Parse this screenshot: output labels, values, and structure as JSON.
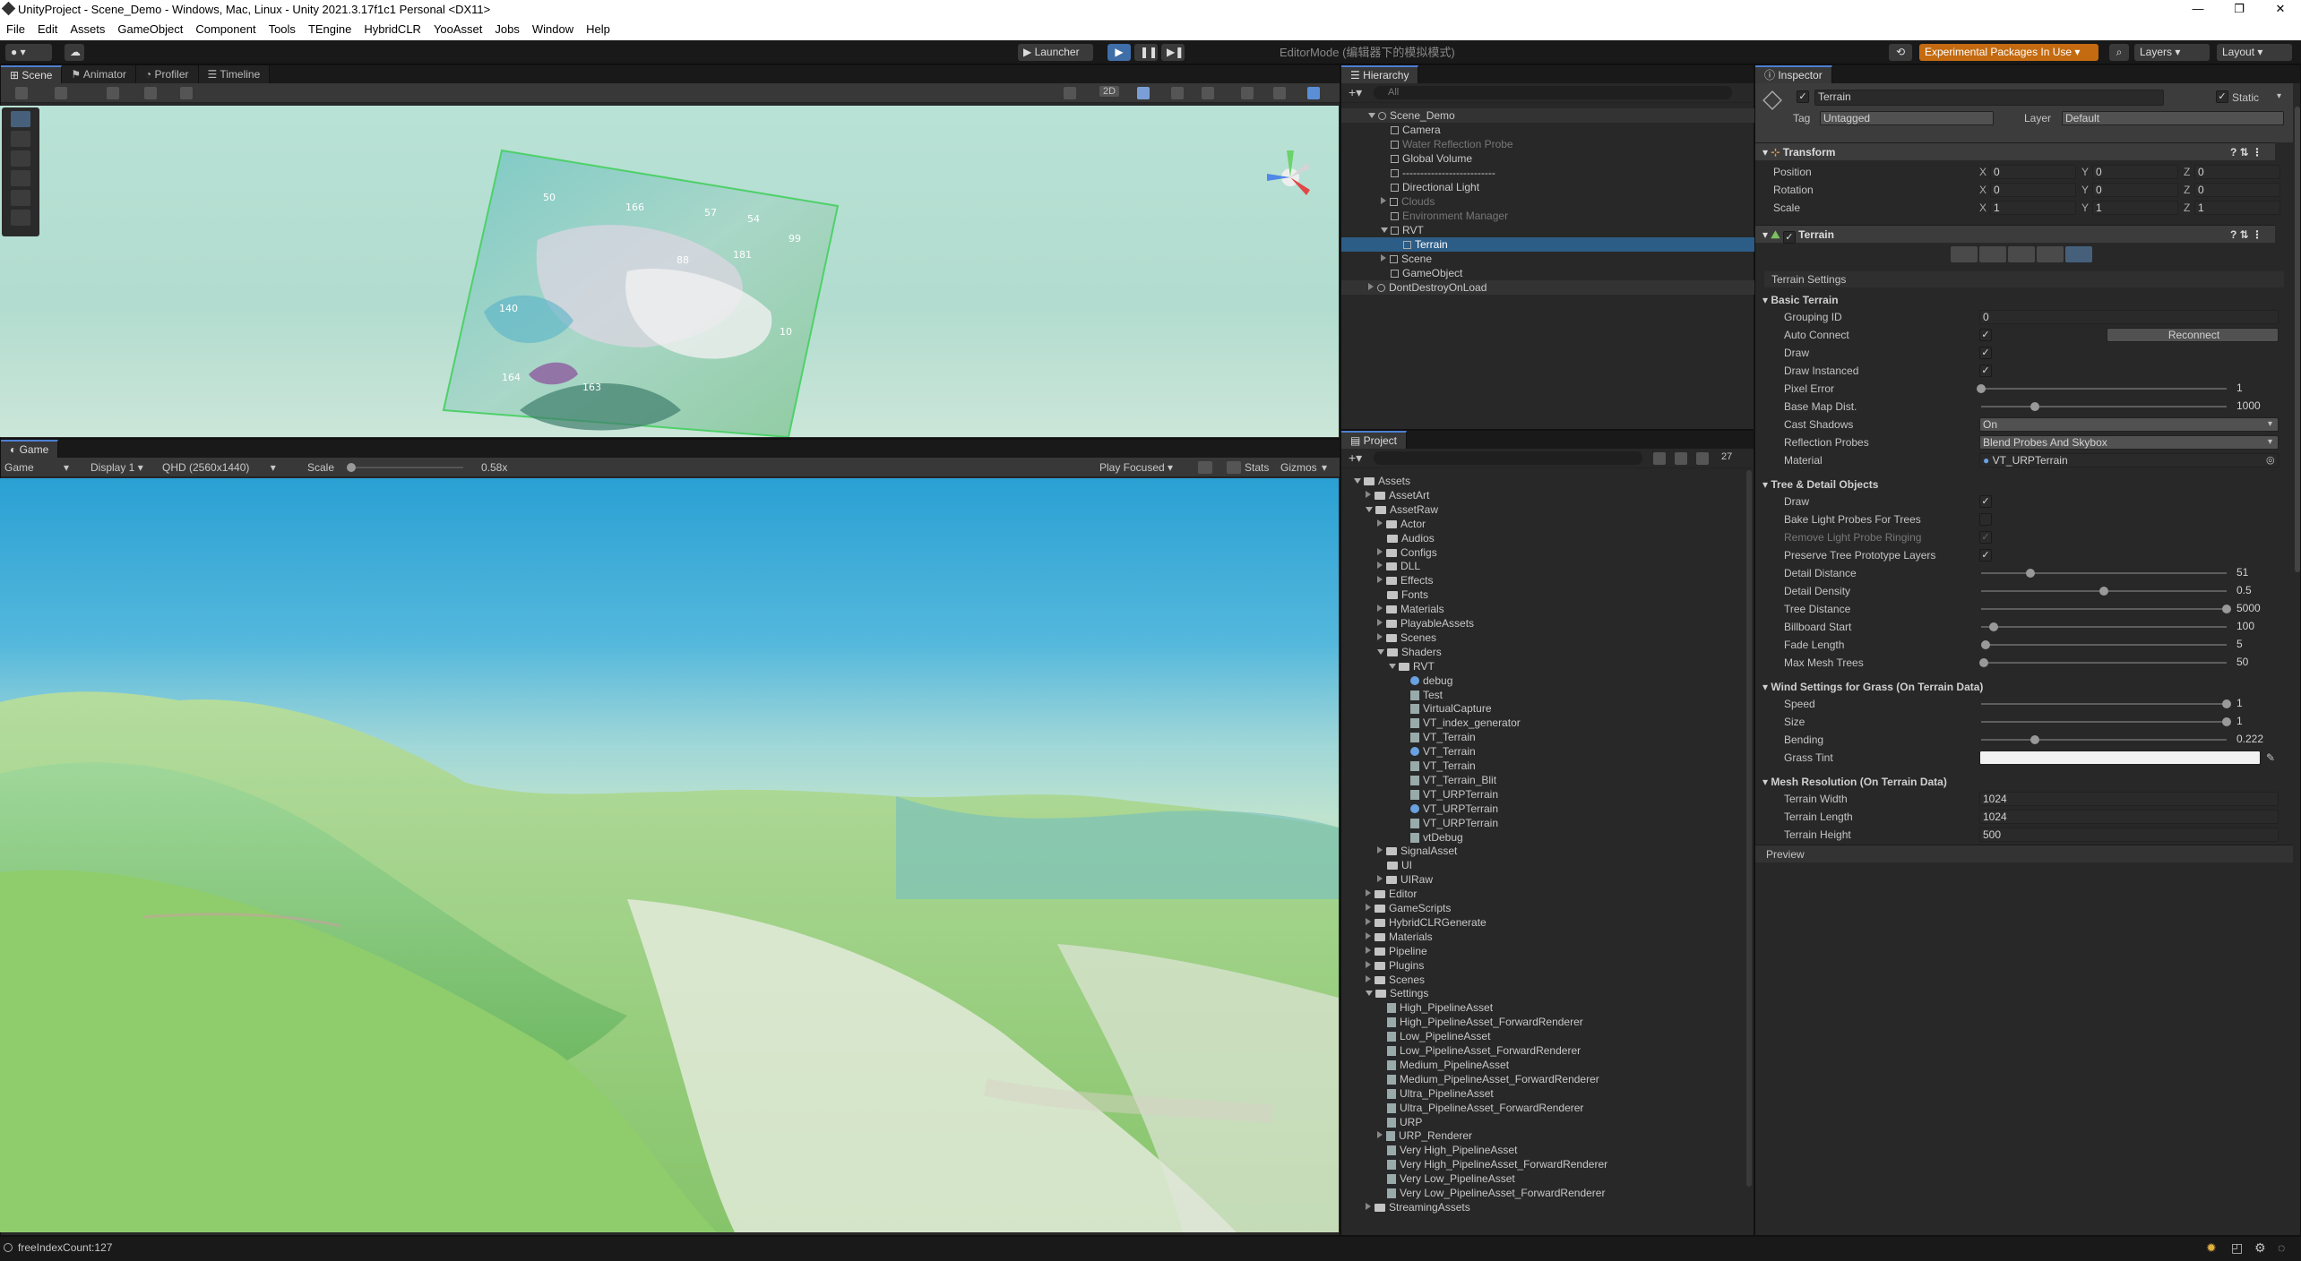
{
  "window": {
    "title": "UnityProject - Scene_Demo - Windows, Mac, Linux - Unity 2021.3.17f1c1 Personal <DX11>",
    "controls": [
      "—",
      "❐",
      "✕"
    ]
  },
  "menu": [
    "File",
    "Edit",
    "Assets",
    "GameObject",
    "Component",
    "Tools",
    "TEngine",
    "HybridCLR",
    "YooAsset",
    "Jobs",
    "Window",
    "Help"
  ],
  "toolbar": {
    "launcher": "Launcher",
    "mode": "EditorMode (编辑器下的模拟模式)",
    "experimental": "Experimental Packages In Use ▾",
    "layers": "Layers",
    "layout": "Layout"
  },
  "scene_tabs": [
    "Scene",
    "Animator",
    "Profiler",
    "Timeline"
  ],
  "scene": {
    "view_2d": "2D",
    "terrain_numbers": [
      "166",
      "57",
      "50",
      "88",
      "140",
      "164",
      "163",
      "181",
      "99",
      "54",
      "10"
    ]
  },
  "game": {
    "tab": "Game",
    "display_mode": "Game",
    "display": "Display 1",
    "resolution": "QHD (2560x1440)",
    "scale_label": "Scale",
    "scale_value": "0.58x",
    "scale_level": 0.04,
    "play_focused": "Play Focused",
    "stats": "Stats",
    "gizmos": "Gizmos"
  },
  "hierarchy": {
    "tab": "Hierarchy",
    "search": "All",
    "items": [
      {
        "label": "Scene_Demo",
        "depth": 0,
        "kind": "scene",
        "expanded": true
      },
      {
        "label": "Camera",
        "depth": 1,
        "kind": "go"
      },
      {
        "label": "Water Reflection Probe",
        "depth": 1,
        "kind": "go",
        "dim": true
      },
      {
        "label": "Global Volume",
        "depth": 1,
        "kind": "go"
      },
      {
        "label": "--------------------------",
        "depth": 1,
        "kind": "go"
      },
      {
        "label": "Directional Light",
        "depth": 1,
        "kind": "go"
      },
      {
        "label": "Clouds",
        "depth": 1,
        "kind": "go",
        "dim": true,
        "collapsed": true
      },
      {
        "label": "Environment Manager",
        "depth": 1,
        "kind": "go",
        "dim": true
      },
      {
        "label": "RVT",
        "depth": 1,
        "kind": "go",
        "expanded": true
      },
      {
        "label": "Terrain",
        "depth": 2,
        "kind": "go",
        "selected": true
      },
      {
        "label": "Scene",
        "depth": 1,
        "kind": "go",
        "collapsed": true
      },
      {
        "label": "GameObject",
        "depth": 1,
        "kind": "go"
      },
      {
        "label": "DontDestroyOnLoad",
        "depth": 0,
        "kind": "scene",
        "collapsed": true
      }
    ]
  },
  "project": {
    "tab": "Project",
    "count": "27",
    "items": [
      {
        "label": "Assets",
        "depth": 0,
        "kind": "folder",
        "expanded": true
      },
      {
        "label": "AssetArt",
        "depth": 1,
        "kind": "folder",
        "collapsed": true
      },
      {
        "label": "AssetRaw",
        "depth": 1,
        "kind": "folder",
        "expanded": true
      },
      {
        "label": "Actor",
        "depth": 2,
        "kind": "folder",
        "collapsed": true
      },
      {
        "label": "Audios",
        "depth": 2,
        "kind": "folder"
      },
      {
        "label": "Configs",
        "depth": 2,
        "kind": "folder",
        "collapsed": true
      },
      {
        "label": "DLL",
        "depth": 2,
        "kind": "folder",
        "collapsed": true
      },
      {
        "label": "Effects",
        "depth": 2,
        "kind": "folder",
        "collapsed": true
      },
      {
        "label": "Fonts",
        "depth": 2,
        "kind": "folder"
      },
      {
        "label": "Materials",
        "depth": 2,
        "kind": "folder",
        "collapsed": true
      },
      {
        "label": "PlayableAssets",
        "depth": 2,
        "kind": "folder",
        "collapsed": true
      },
      {
        "label": "Scenes",
        "depth": 2,
        "kind": "folder",
        "collapsed": true
      },
      {
        "label": "Shaders",
        "depth": 2,
        "kind": "folder",
        "expanded": true
      },
      {
        "label": "RVT",
        "depth": 3,
        "kind": "folder",
        "expanded": true
      },
      {
        "label": "debug",
        "depth": 4,
        "kind": "circle"
      },
      {
        "label": "Test",
        "depth": 4,
        "kind": "file"
      },
      {
        "label": "VirtualCapture",
        "depth": 4,
        "kind": "file"
      },
      {
        "label": "VT_index_generator",
        "depth": 4,
        "kind": "file"
      },
      {
        "label": "VT_Terrain",
        "depth": 4,
        "kind": "file"
      },
      {
        "label": "VT_Terrain",
        "depth": 4,
        "kind": "circle"
      },
      {
        "label": "VT_Terrain",
        "depth": 4,
        "kind": "file"
      },
      {
        "label": "VT_Terrain_Blit",
        "depth": 4,
        "kind": "file"
      },
      {
        "label": "VT_URPTerrain",
        "depth": 4,
        "kind": "file"
      },
      {
        "label": "VT_URPTerrain",
        "depth": 4,
        "kind": "circle"
      },
      {
        "label": "VT_URPTerrain",
        "depth": 4,
        "kind": "file"
      },
      {
        "label": "vtDebug",
        "depth": 4,
        "kind": "file"
      },
      {
        "label": "SignalAsset",
        "depth": 2,
        "kind": "folder",
        "collapsed": true
      },
      {
        "label": "UI",
        "depth": 2,
        "kind": "folder"
      },
      {
        "label": "UIRaw",
        "depth": 2,
        "kind": "folder",
        "collapsed": true
      },
      {
        "label": "Editor",
        "depth": 1,
        "kind": "folder",
        "collapsed": true
      },
      {
        "label": "GameScripts",
        "depth": 1,
        "kind": "folder",
        "collapsed": true
      },
      {
        "label": "HybridCLRGenerate",
        "depth": 1,
        "kind": "folder",
        "collapsed": true
      },
      {
        "label": "Materials",
        "depth": 1,
        "kind": "folder",
        "collapsed": true
      },
      {
        "label": "Pipeline",
        "depth": 1,
        "kind": "folder",
        "collapsed": true
      },
      {
        "label": "Plugins",
        "depth": 1,
        "kind": "folder",
        "collapsed": true
      },
      {
        "label": "Scenes",
        "depth": 1,
        "kind": "folder",
        "collapsed": true
      },
      {
        "label": "Settings",
        "depth": 1,
        "kind": "folder",
        "expanded": true
      },
      {
        "label": "High_PipelineAsset",
        "depth": 2,
        "kind": "file"
      },
      {
        "label": "High_PipelineAsset_ForwardRenderer",
        "depth": 2,
        "kind": "file"
      },
      {
        "label": "Low_PipelineAsset",
        "depth": 2,
        "kind": "file"
      },
      {
        "label": "Low_PipelineAsset_ForwardRenderer",
        "depth": 2,
        "kind": "file"
      },
      {
        "label": "Medium_PipelineAsset",
        "depth": 2,
        "kind": "file"
      },
      {
        "label": "Medium_PipelineAsset_ForwardRenderer",
        "depth": 2,
        "kind": "file"
      },
      {
        "label": "Ultra_PipelineAsset",
        "depth": 2,
        "kind": "file"
      },
      {
        "label": "Ultra_PipelineAsset_ForwardRenderer",
        "depth": 2,
        "kind": "file"
      },
      {
        "label": "URP",
        "depth": 2,
        "kind": "file"
      },
      {
        "label": "URP_Renderer",
        "depth": 2,
        "kind": "file",
        "collapsed": true
      },
      {
        "label": "Very High_PipelineAsset",
        "depth": 2,
        "kind": "file"
      },
      {
        "label": "Very High_PipelineAsset_ForwardRenderer",
        "depth": 2,
        "kind": "file"
      },
      {
        "label": "Very Low_PipelineAsset",
        "depth": 2,
        "kind": "file"
      },
      {
        "label": "Very Low_PipelineAsset_ForwardRenderer",
        "depth": 2,
        "kind": "file"
      },
      {
        "label": "StreamingAssets",
        "depth": 1,
        "kind": "folder",
        "collapsed": true
      }
    ]
  },
  "inspector": {
    "tab": "Inspector",
    "name": "Terrain",
    "static": "Static",
    "tag_label": "Tag",
    "tag": "Untagged",
    "layer_label": "Layer",
    "layer": "Default",
    "transform": {
      "title": "Transform",
      "rows": [
        {
          "label": "Position",
          "x": "0",
          "y": "0",
          "z": "0"
        },
        {
          "label": "Rotation",
          "x": "0",
          "y": "0",
          "z": "0"
        },
        {
          "label": "Scale",
          "x": "1",
          "y": "1",
          "z": "1"
        }
      ]
    },
    "terrain_title": "Terrain",
    "settings_label": "Terrain Settings",
    "sections": [
      {
        "title": "Basic Terrain",
        "rows": [
          {
            "label": "Grouping ID",
            "type": "text",
            "value": "0"
          },
          {
            "label": "Auto Connect",
            "type": "check",
            "value": "✓",
            "button": "Reconnect"
          },
          {
            "label": "Draw",
            "type": "check",
            "value": "✓"
          },
          {
            "label": "Draw Instanced",
            "type": "check",
            "value": "✓"
          },
          {
            "label": "Pixel Error",
            "type": "slider",
            "value": "1",
            "level": 0.0
          },
          {
            "label": "Base Map Dist.",
            "type": "slider",
            "value": "1000",
            "level": 0.22
          },
          {
            "label": "Cast Shadows",
            "type": "dropdown",
            "value": "On"
          },
          {
            "label": "Reflection Probes",
            "type": "dropdown",
            "value": "Blend Probes And Skybox"
          },
          {
            "label": "Material",
            "type": "object",
            "value": "VT_URPTerrain"
          }
        ]
      },
      {
        "title": "Tree & Detail Objects",
        "rows": [
          {
            "label": "Draw",
            "type": "check",
            "value": "✓"
          },
          {
            "label": "Bake Light Probes For Trees",
            "type": "check",
            "value": ""
          },
          {
            "label": "Remove Light Probe Ringing",
            "type": "check",
            "value": "✓",
            "dim": true
          },
          {
            "label": "Preserve Tree Prototype Layers",
            "type": "check",
            "value": "✓"
          },
          {
            "label": "Detail Distance",
            "type": "slider",
            "value": "51",
            "level": 0.2
          },
          {
            "label": "Detail Density",
            "type": "slider",
            "value": "0.5",
            "level": 0.5
          },
          {
            "label": "Tree Distance",
            "type": "slider",
            "value": "5000",
            "level": 1.0
          },
          {
            "label": "Billboard Start",
            "type": "slider",
            "value": "100",
            "level": 0.05
          },
          {
            "label": "Fade Length",
            "type": "slider",
            "value": "5",
            "level": 0.02
          },
          {
            "label": "Max Mesh Trees",
            "type": "slider",
            "value": "50",
            "level": 0.01
          }
        ]
      },
      {
        "title": "Wind Settings for Grass (On Terrain Data)",
        "rows": [
          {
            "label": "Speed",
            "type": "slider",
            "value": "1",
            "level": 1.0
          },
          {
            "label": "Size",
            "type": "slider",
            "value": "1",
            "level": 1.0
          },
          {
            "label": "Bending",
            "type": "slider",
            "value": "0.222",
            "level": 0.22
          },
          {
            "label": "Grass Tint",
            "type": "color",
            "value": ""
          }
        ]
      },
      {
        "title": "Mesh Resolution (On Terrain Data)",
        "rows": [
          {
            "label": "Terrain Width",
            "type": "text",
            "value": "1024"
          },
          {
            "label": "Terrain Length",
            "type": "text",
            "value": "1024"
          },
          {
            "label": "Terrain Height",
            "type": "text",
            "value": "500"
          }
        ]
      }
    ],
    "preview": "Preview"
  },
  "status": {
    "message": "freeIndexCount:127"
  }
}
